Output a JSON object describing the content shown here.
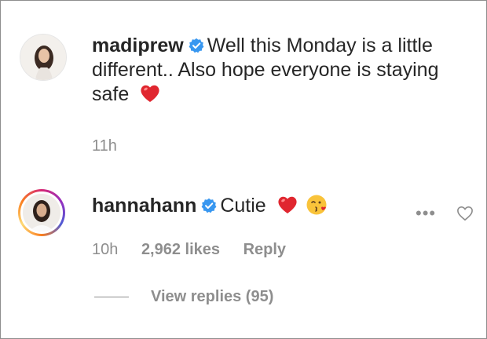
{
  "comments": [
    {
      "username": "madiprew",
      "text": "Well this Monday is a little different.. Also hope everyone is staying safe",
      "time": "11h"
    },
    {
      "username": "hannahann",
      "text": "Cutie",
      "time": "10h",
      "likes": "2,962 likes",
      "reply_label": "Reply",
      "more_label": "•••",
      "view_replies": "View replies (95)"
    }
  ],
  "icons": {
    "verified": "verified-badge-icon",
    "heart_emoji": "red-heart-emoji-icon",
    "kiss_emoji": "kissing-face-emoji-icon",
    "like": "heart-outline-icon",
    "more": "more-dots-icon"
  },
  "colors": {
    "text": "#262626",
    "secondary": "#8e8e8e",
    "verified": "#3897f0",
    "heart": "#ed4956"
  }
}
